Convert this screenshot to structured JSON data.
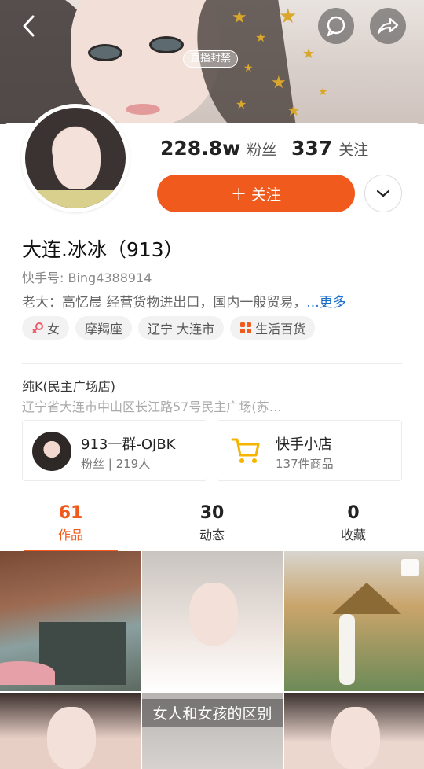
{
  "header": {
    "live_ban_label": "直播封禁",
    "buttons": [
      "back",
      "message",
      "share"
    ]
  },
  "stats": {
    "fans_count": "228.8w",
    "fans_label": "粉丝",
    "following_count": "337",
    "following_label": "关注"
  },
  "actions": {
    "follow_label": "关注"
  },
  "profile": {
    "name": "大连.冰冰（913）",
    "kuaishou_id": "快手号: Bing4388914",
    "bio": "老大：高忆晨 经营货物进出口，国内一般贸易，",
    "bio_more": "...更多",
    "tags": [
      {
        "icon": "female-icon",
        "label": "女"
      },
      {
        "icon": "",
        "label": "摩羯座"
      },
      {
        "icon": "",
        "label": "辽宁 大连市"
      },
      {
        "icon": "grid-icon",
        "label": "生活百货"
      }
    ]
  },
  "location": {
    "title": "纯K(民主广场店)",
    "address": "辽宁省大连市中山区长江路57号民主广场(苏…"
  },
  "group": {
    "title": "913一群-OJBK",
    "subtitle": "粉丝 | 219人"
  },
  "shop": {
    "title": "快手小店",
    "subtitle": "137件商品"
  },
  "tabs": [
    {
      "count": "61",
      "label": "作品",
      "active": true
    },
    {
      "count": "30",
      "label": "动态",
      "active": false
    },
    {
      "count": "0",
      "label": "收藏",
      "active": false
    }
  ],
  "grid": {
    "overlay_text": "女人和女孩的区别"
  },
  "colors": {
    "accent": "#f05a1c",
    "link": "#1b6fc8"
  }
}
